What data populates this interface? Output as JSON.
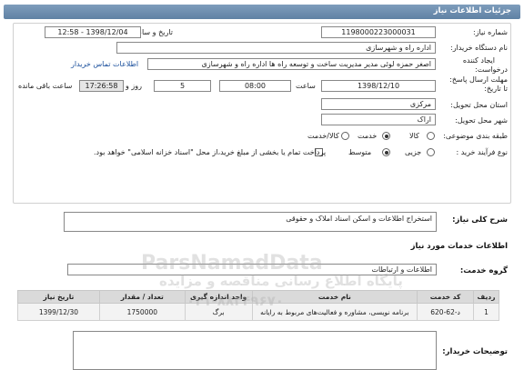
{
  "header": {
    "title": "جزئیات اطلاعات نیاز"
  },
  "form": {
    "need_number_label": "شماره نیاز:",
    "need_number": "1198000223000031",
    "announce_label": "تاریخ و ساعت اعلان عمومی:",
    "announce_value": "1398/12/04 - 12:58",
    "buyer_org_label": "نام دستگاه خریدار:",
    "buyer_org": "اداره راه و شهرسازی",
    "creator_label_1": "ایجاد کننده",
    "creator_label_2": "درخواست:",
    "creator": "اصغر حمزه لوئی مدیر مدیریت ساخت و توسعه  راه ها اداره راه و شهرسازی",
    "buyer_contact_link": "اطلاعات تماس خریدار",
    "deadline_label_1": "مهلت ارسال پاسخ:",
    "deadline_label_2": "تا تاریخ:",
    "deadline_date": "1398/12/10",
    "time_label": "ساعت",
    "deadline_time": "08:00",
    "days_value": "5",
    "days_label": "روز و",
    "remaining_time": "17:26:58",
    "remaining_label": "ساعت باقی مانده",
    "province_label": "استان محل تحویل:",
    "province": "مرکزی",
    "city_label": "شهر محل تحویل:",
    "city": "اراک",
    "category_label": "طبقه بندی موضوعی:",
    "category_options": [
      "کالا",
      "خدمت",
      "کالا/خدمت"
    ],
    "process_label": "نوع فرآیند خرید :",
    "process_options": [
      "جزیی",
      "متوسط"
    ],
    "payment_note": "پرداخت تمام یا بخشی از مبلغ خرید،از محل \"اسناد خزانه اسلامی\" خواهد بود."
  },
  "description": {
    "label": "شرح کلی نیاز:",
    "value": "استخراج اطلاعات و اسکن اسناد املاک و حقوقی"
  },
  "services_section": {
    "title": "اطلاعات خدمات مورد نیاز",
    "group_label": "گروه خدمت:",
    "group_value": "اطلاعات و ارتباطات"
  },
  "table": {
    "headers": [
      "ردیف",
      "کد خدمت",
      "نام خدمت",
      "واحد اندازه گیری",
      "تعداد / مقدار",
      "تاریخ نیاز"
    ],
    "rows": [
      [
        "1",
        "د-62-620",
        "برنامه نویسی، مشاوره و فعالیت‌های مربوط به رایانه",
        "برگ",
        "1750000",
        "1399/12/30"
      ]
    ]
  },
  "buyer_notes": {
    "label": "توضیحات خریدار:"
  },
  "watermark": {
    "line1": "ParsNamadData",
    "line2": "پایگاه اطلاع رسانی مناقصه و مزایده",
    "line3": "۰۲۱-۸۸۳۴۹۶۷۰"
  }
}
